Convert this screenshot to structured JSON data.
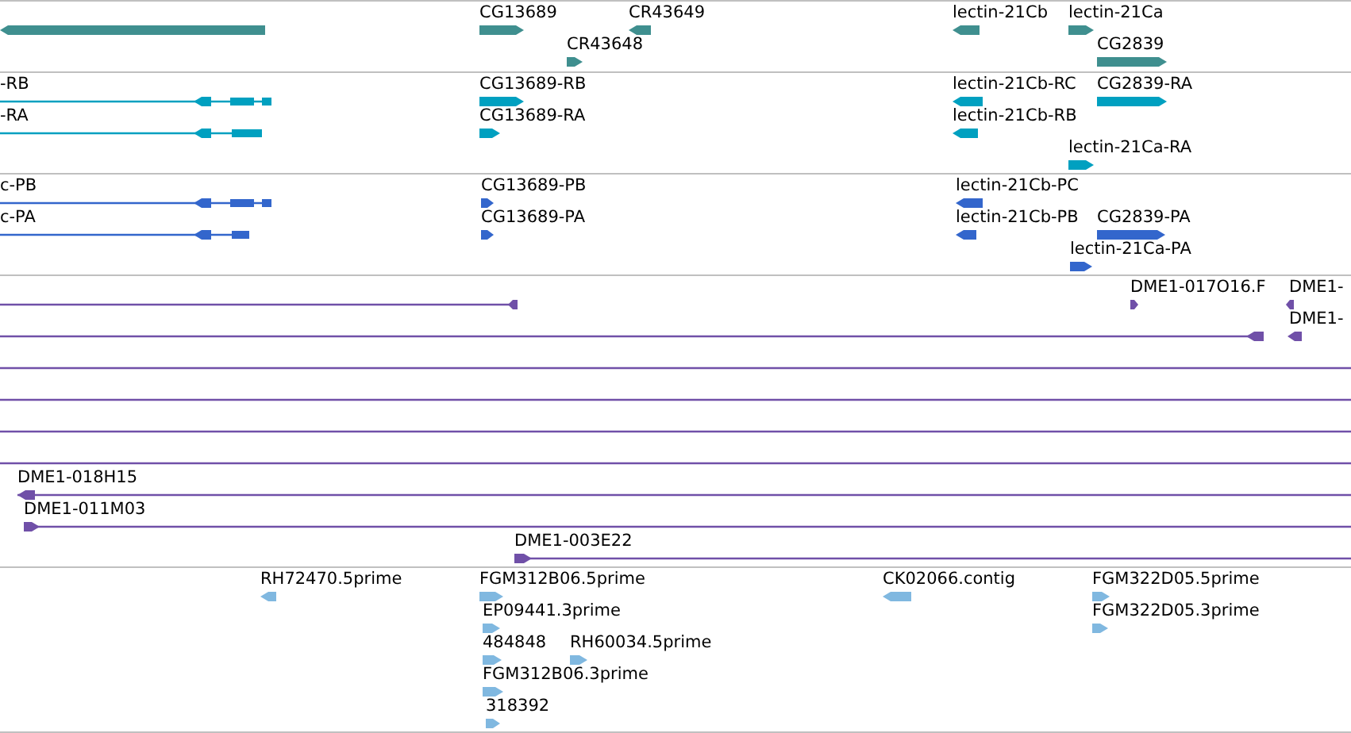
{
  "tracks": [
    {
      "color": "#3f8f8f",
      "features": [
        {
          "reverse": true
        },
        {
          "label": "CG13689",
          "reverse": false
        },
        {
          "label": "CR43649",
          "reverse": true
        },
        {
          "label": "lectin-21Cb",
          "reverse": true
        },
        {
          "label": "lectin-21Ca",
          "reverse": false
        },
        {
          "label": "CR43648",
          "reverse": false
        },
        {
          "label": "CG2839",
          "reverse": false
        }
      ]
    },
    {
      "color": "#00a0c0",
      "features": [
        {
          "label": "-RB",
          "reverse": true
        },
        {
          "label": "CG13689-RB",
          "reverse": false
        },
        {
          "label": "lectin-21Cb-RC",
          "reverse": true
        },
        {
          "label": "CG2839-RA",
          "reverse": false
        },
        {
          "label": "-RA",
          "reverse": true
        },
        {
          "label": "CG13689-RA",
          "reverse": false
        },
        {
          "label": "lectin-21Cb-RB",
          "reverse": true
        },
        {
          "label": "lectin-21Ca-RA",
          "reverse": false
        }
      ]
    },
    {
      "color": "#3366cc",
      "features": [
        {
          "label": "c-PB",
          "reverse": true
        },
        {
          "label": "CG13689-PB",
          "reverse": false
        },
        {
          "label": "lectin-21Cb-PC",
          "reverse": true
        },
        {
          "label": "c-PA",
          "reverse": true
        },
        {
          "label": "CG13689-PA",
          "reverse": false
        },
        {
          "label": "lectin-21Cb-PB",
          "reverse": true
        },
        {
          "label": "CG2839-PA",
          "reverse": false
        },
        {
          "label": "lectin-21Ca-PA",
          "reverse": false
        }
      ]
    },
    {
      "color": "#7050a8",
      "features": [
        {
          "kind": "arrow",
          "reverse": true
        },
        {
          "kind": "arrow",
          "label": "DME1-017O16.F",
          "reverse": false
        },
        {
          "kind": "arrow",
          "label": "DME1-",
          "reverse": true
        },
        {
          "kind": "arrow",
          "reverse": true
        },
        {
          "kind": "arrow",
          "label": "DME1-",
          "reverse": true
        },
        {
          "kind": "line"
        },
        {
          "kind": "line"
        },
        {
          "kind": "line"
        },
        {
          "kind": "line"
        },
        {
          "kind": "arrow",
          "label": "DME1-018H15",
          "reverse": true
        },
        {
          "kind": "arrow",
          "label": "DME1-011M03",
          "reverse": false
        },
        {
          "kind": "arrow",
          "label": "DME1-003E22",
          "reverse": false
        }
      ]
    },
    {
      "color": "#80b8e0",
      "features": [
        {
          "label": "RH72470.5prime",
          "reverse": true
        },
        {
          "label": "FGM312B06.5prime",
          "reverse": false
        },
        {
          "label": "CK02066.contig",
          "reverse": true
        },
        {
          "label": "FGM322D05.5prime",
          "reverse": false
        },
        {
          "label": "EP09441.3prime",
          "reverse": false
        },
        {
          "label": "FGM322D05.3prime",
          "reverse": false
        },
        {
          "label": "484848",
          "reverse": false
        },
        {
          "label": "RH60034.5prime",
          "reverse": false
        },
        {
          "label": "FGM312B06.3prime",
          "reverse": false
        },
        {
          "label": "318392",
          "reverse": false
        }
      ]
    }
  ]
}
